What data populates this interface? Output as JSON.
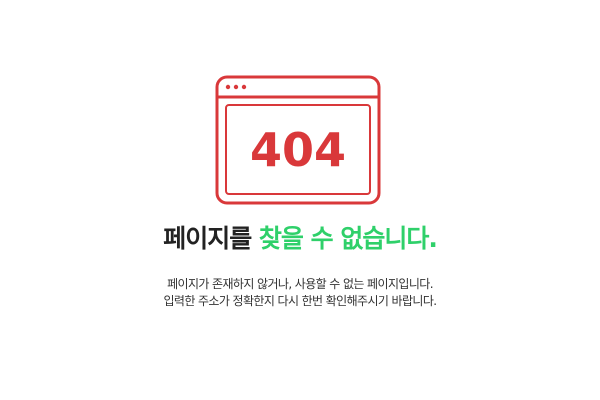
{
  "illustration": {
    "icon": "browser-window-icon",
    "error_code": "404",
    "color": "#d9383a"
  },
  "heading": {
    "prefix": "페이지를 ",
    "highlight": "찾을 수 없습니다.",
    "highlight_color": "#2fd06a"
  },
  "description": {
    "line1": "페이지가 존재하지 않거나, 사용할 수 없는 페이지입니다.",
    "line2": "입력한 주소가 정확한지 다시 한번 확인해주시기 바랍니다."
  }
}
